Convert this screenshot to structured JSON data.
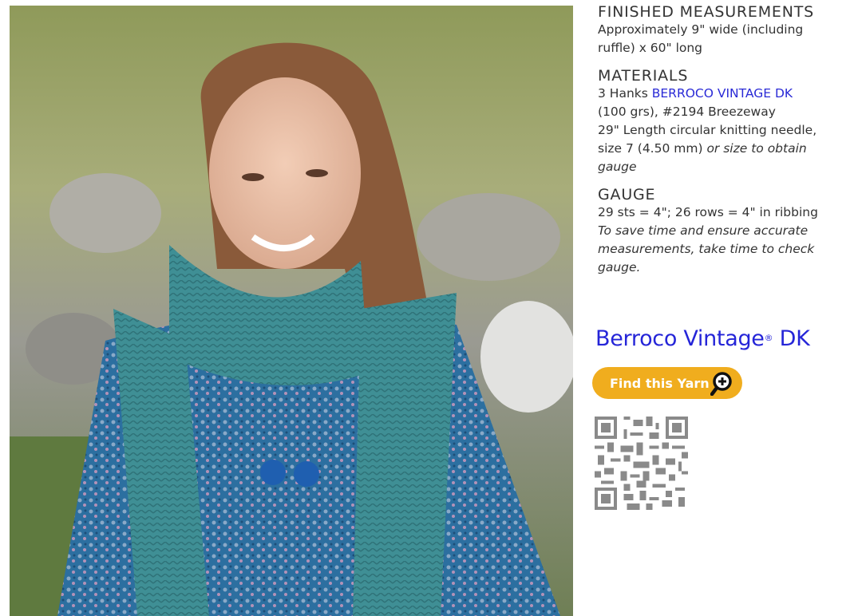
{
  "photo": {
    "alt": ""
  },
  "finished": {
    "heading": "FINISHED MEASUREMENTS",
    "line1": "Approximately 9\" wide (including",
    "line2": "ruffle) x 60\" long"
  },
  "materials": {
    "heading": "MATERIALS",
    "line1_prefix": "3 Hanks ",
    "line1_link": "BERROCO VINTAGE DK",
    "line2": "(100 grs), #2194 Breezeway",
    "line3": "29\" Length circular knitting needle,",
    "line4_a": "size 7 (4.50 mm) ",
    "line4_b": "or size to obtain",
    "line5": "gauge"
  },
  "gauge": {
    "heading": "GAUGE",
    "line1": "29 sts = 4\"; 26 rows = 4\" in ribbing",
    "line2": "To save time and ensure accurate",
    "line3": "measurements, take time to check",
    "line4": "gauge."
  },
  "brand": {
    "name": "Berroco Vintage",
    "reg": "®",
    "suffix": " DK",
    "color": "#2525d8"
  },
  "find_button": {
    "label": "Find this Yarn",
    "color": "#f0ad1e",
    "icon": "magnifier-plus-icon"
  },
  "qr": {
    "icon": "qr-code"
  }
}
